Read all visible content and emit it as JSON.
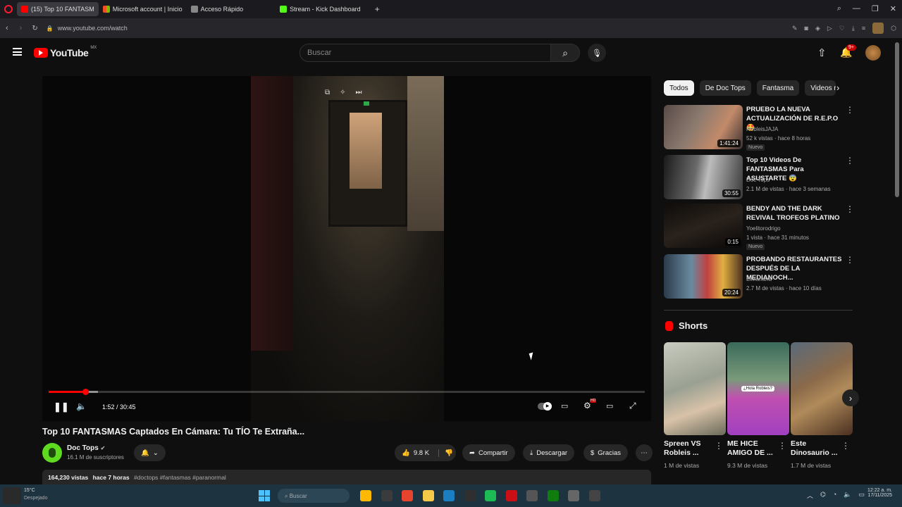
{
  "browser": {
    "tabs": [
      {
        "label": "(15) Top 10 FANTASM",
        "active": true,
        "color": "#ff0000"
      },
      {
        "label": "Microsoft account | Inicio",
        "active": false,
        "color": "#00a4ef"
      },
      {
        "label": "Acceso Rápido",
        "active": false,
        "color": "#888888"
      },
      {
        "label": "Stream - Kick Dashboard",
        "active": false,
        "color": "#53fc18"
      }
    ],
    "new_tab": "+",
    "url": "www.youtube.com/watch"
  },
  "header": {
    "logo_text": "YouTube",
    "country": "MX",
    "search_placeholder": "Buscar",
    "notifications_count": "9+"
  },
  "player": {
    "time": "1:52 / 30:45",
    "progress_fraction": 0.061,
    "buffer_fraction": 0.083,
    "hd_badge": "HD"
  },
  "video": {
    "title": "Top 10 FANTASMAS Captados En Cámara: Tu TÍO Te Extraña...",
    "channel": "Doc Tops",
    "subscribers": "16.1 M de suscriptores",
    "likes": "9.8 K",
    "share": "Compartir",
    "download": "Descargar",
    "thanks": "Gracias",
    "views": "164,230 vistas",
    "age": "hace 7 horas",
    "hashtags": "#doctops #fantasmas #paranormal"
  },
  "chips": [
    "Todos",
    "De Doc Tops",
    "Fantasma",
    "Videos re"
  ],
  "recommendations": [
    {
      "title": "PRUEBO LA NUEVA ACTUALIZACIÓN DE R.E.P.O 🤩",
      "channel": "RobleisJAJA",
      "meta": "52 k vistas · hace 8 horas",
      "badge": "Nuevo",
      "duration": "1:41:24"
    },
    {
      "title": "Top 10 Videos De FANTASMAS Para ASUSTARTE 😨",
      "channel": "Doc Tops",
      "meta": "2.1 M de vistas · hace 3 semanas",
      "badge": "",
      "duration": "30:55"
    },
    {
      "title": "BENDY AND THE DARK REVIVAL TROFEOS PLATINO",
      "channel": "Yoelitorodrigo",
      "meta": "1 vista · hace 31 minutos",
      "badge": "Nuevo",
      "duration": "0:15"
    },
    {
      "title": "PROBANDO RESTAURANTES DESPUÉS DE LA MEDIANOCH...",
      "channel": "ElMariana",
      "meta": "2.7 M de vistas · hace 10 días",
      "badge": "",
      "duration": "20:24"
    }
  ],
  "shorts": {
    "heading": "Shorts",
    "items": [
      {
        "title": "Spreen VS Robleis ...",
        "views": "1 M de vistas",
        "overlay": ""
      },
      {
        "title": "ME HICE AMIGO DE ...",
        "views": "9.3 M de vistas",
        "overlay": "¿Hola Robleis?"
      },
      {
        "title": "Este Dinosaurio ...",
        "views": "1.7 M de vistas",
        "overlay": ""
      }
    ]
  },
  "taskbar": {
    "weather_temp": "15°C",
    "weather_desc": "Despejado",
    "search": "Buscar",
    "time": "12:22 a. m.",
    "date": "17/11/2025",
    "apps": [
      "#ffb900",
      "#3b3b3b",
      "#e8432d",
      "#f7c948",
      "#1b7ec2",
      "#2f2f2f",
      "#1db954",
      "#cc0f16",
      "#555555",
      "#107c10",
      "#666666",
      "#444444"
    ]
  }
}
